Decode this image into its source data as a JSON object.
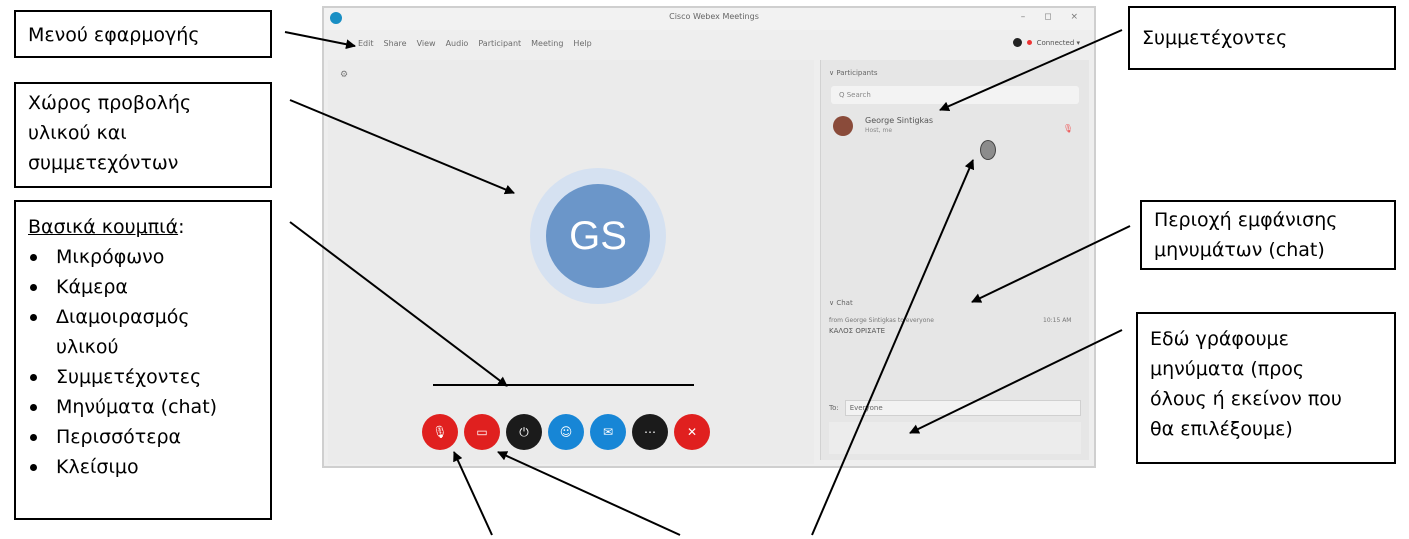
{
  "callouts": {
    "app_menu": "Μενού εφαρμογής",
    "content_area": [
      "Χώρος προβολής",
      "υλικού και",
      "συμμετεχόντων"
    ],
    "participants": "Συμμετέχοντες",
    "chat_area": [
      "Περιοχή εμφάνισης",
      "μηνυμάτων (chat)"
    ],
    "compose": [
      "Εδώ γράφουμε",
      "μηνύματα (προς",
      "όλους ή εκείνον που",
      "θα επιλέξουμε)"
    ],
    "buttons": {
      "heading": "Βασικά κουμπιά",
      "heading_suffix": ":",
      "items": [
        "Μικρόφωνο",
        "Κάμερα",
        "Διαμοιρασμός",
        "υλικού",
        "Συμμετέχοντες",
        "Μηνύματα (chat)",
        "Περισσότερα",
        "Κλείσιμο"
      ]
    }
  },
  "window": {
    "title": "Cisco Webex Meetings",
    "controls": "– ◻ ×",
    "menu": [
      "Edit",
      "Share",
      "View",
      "Audio",
      "Participant",
      "Meeting",
      "Help"
    ],
    "status": "Connected ▾",
    "avatar_initials": "GS",
    "participants_header": "∨ Participants",
    "search_placeholder": "Q  Search",
    "participant_name": "George Sintigkas",
    "participant_sub": "Host, me",
    "chat_header": "∨ Chat",
    "chat_meta": "from George Sintigkas to everyone",
    "chat_time": "10:15 AM",
    "chat_message": "ΚΑΛΟΣ ΟΡΙΣΑΤΕ",
    "to_label": "To:",
    "to_value": "Everyone"
  },
  "controls": [
    {
      "name": "mute-button",
      "color": "#e0201f",
      "glyph": "🎙"
    },
    {
      "name": "video-button",
      "color": "#e0201f",
      "glyph": "▭"
    },
    {
      "name": "share-button",
      "color": "#1b1b1b",
      "glyph": "⏻"
    },
    {
      "name": "participants-button",
      "color": "#1786d6",
      "glyph": "☺"
    },
    {
      "name": "chat-button",
      "color": "#1786d6",
      "glyph": "✉"
    },
    {
      "name": "more-button",
      "color": "#1b1b1b",
      "glyph": "⋯"
    },
    {
      "name": "leave-button",
      "color": "#e0201f",
      "glyph": "✕"
    }
  ]
}
